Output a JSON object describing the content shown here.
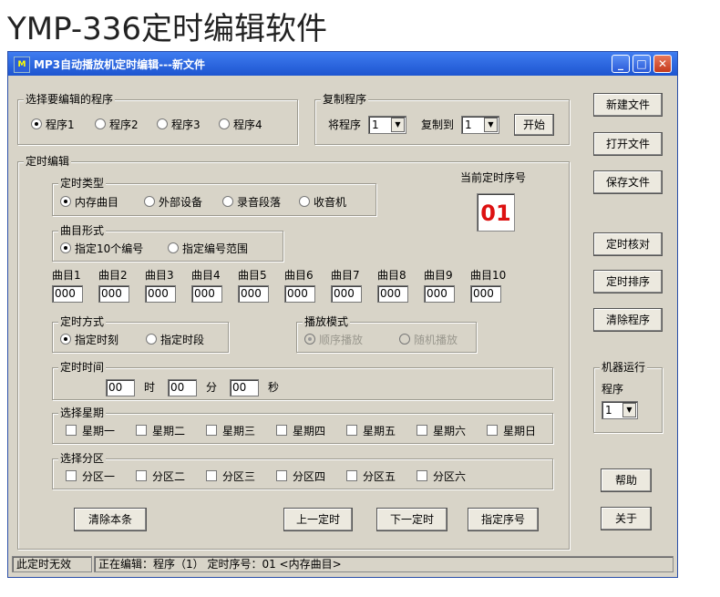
{
  "page_heading": "YMP-336定时编辑软件",
  "window": {
    "title": "MP3自动播放机定时编辑---新文件",
    "icon_name": "app-icon",
    "controls": [
      "minimize-icon",
      "maximize-icon",
      "close-icon"
    ]
  },
  "program_select": {
    "title": "选择要编辑的程序",
    "options": [
      "程序1",
      "程序2",
      "程序3",
      "程序4"
    ],
    "selected": 0
  },
  "copy_program": {
    "title": "复制程序",
    "from_label": "将程序",
    "from_value": "1",
    "to_label": "复制到",
    "to_value": "1",
    "start_button": "开始"
  },
  "timer_edit": {
    "title": "定时编辑",
    "current_seq_label": "当前定时序号",
    "current_seq_value": "01",
    "timer_type": {
      "title": "定时类型",
      "options": [
        "内存曲目",
        "外部设备",
        "录音段落",
        "收音机"
      ],
      "selected": 0
    },
    "track_form": {
      "title": "曲目形式",
      "options": [
        "指定10个编号",
        "指定编号范围"
      ],
      "selected": 0
    },
    "tracks": {
      "labels": [
        "曲目1",
        "曲目2",
        "曲目3",
        "曲目4",
        "曲目5",
        "曲目6",
        "曲目7",
        "曲目8",
        "曲目9",
        "曲目10"
      ],
      "values": [
        "000",
        "000",
        "000",
        "000",
        "000",
        "000",
        "000",
        "000",
        "000",
        "000"
      ]
    },
    "timer_mode": {
      "title": "定时方式",
      "options": [
        "指定时刻",
        "指定时段"
      ],
      "selected": 0
    },
    "play_mode": {
      "title": "播放模式",
      "options": [
        "顺序播放",
        "随机播放"
      ],
      "selected": 0,
      "disabled": true
    },
    "timer_time": {
      "title": "定时时间",
      "hour": "00",
      "hour_unit": "时",
      "minute": "00",
      "minute_unit": "分",
      "second": "00",
      "second_unit": "秒"
    },
    "weekdays": {
      "title": "选择星期",
      "items": [
        "星期一",
        "星期二",
        "星期三",
        "星期四",
        "星期五",
        "星期六",
        "星期日"
      ]
    },
    "zones": {
      "title": "选择分区",
      "items": [
        "分区一",
        "分区二",
        "分区三",
        "分区四",
        "分区五",
        "分区六"
      ]
    },
    "buttons": {
      "clear_entry": "清除本条",
      "prev": "上一定时",
      "next": "下一定时",
      "goto_seq": "指定序号"
    }
  },
  "side_buttons": {
    "new_file": "新建文件",
    "open_file": "打开文件",
    "save_file": "保存文件",
    "check_timer": "定时核对",
    "sort_timer": "定时排序",
    "clear_program": "清除程序",
    "help": "帮助",
    "about": "关于"
  },
  "machine_run": {
    "title": "机器运行",
    "program_label": "程序",
    "program_value": "1"
  },
  "status_bar": {
    "validity": "此定时无效",
    "editing": "正在编辑：程序（1）   定时序号：01   <内存曲目>"
  }
}
